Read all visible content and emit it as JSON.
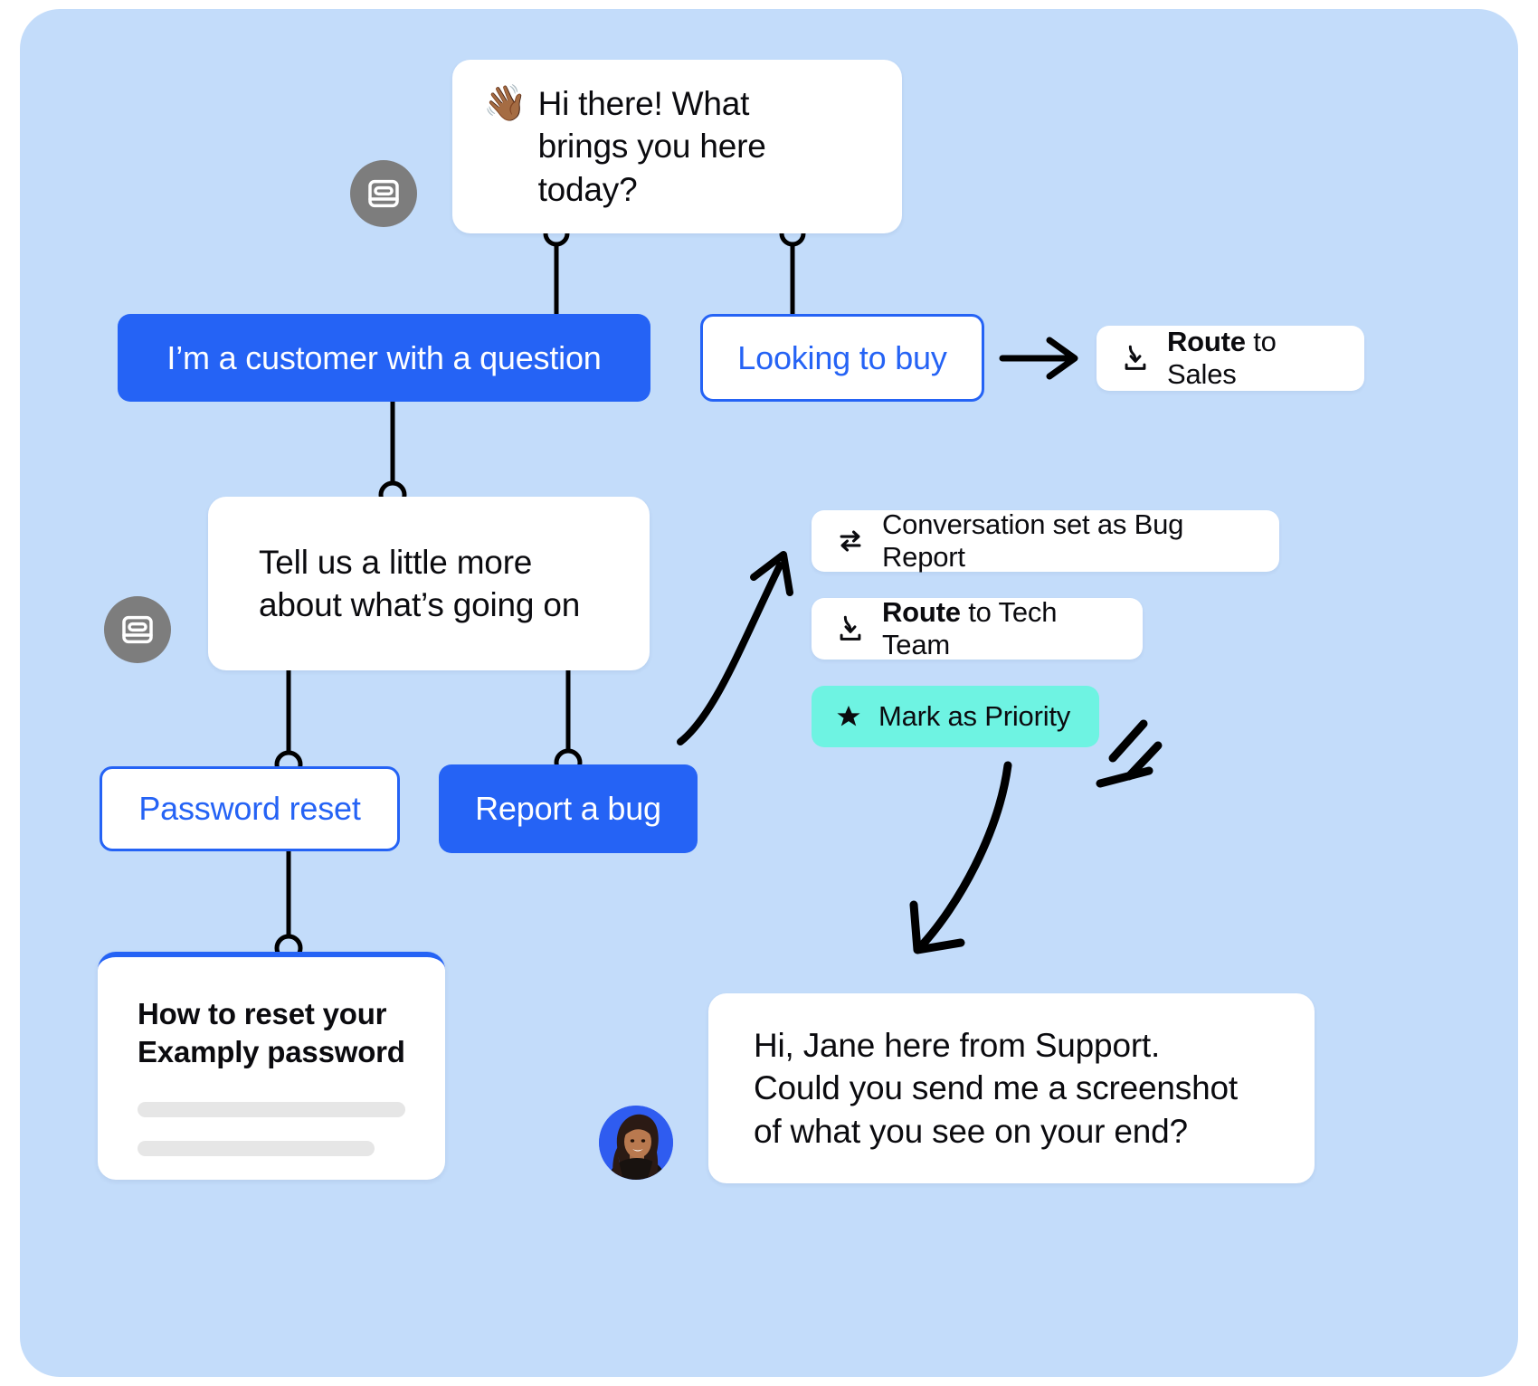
{
  "colors": {
    "stage_bg": "#c3dcfa",
    "primary_blue": "#2563f5",
    "mint": "#6ef3e2",
    "bot_avatar_gray": "#7d7d7d",
    "card_white": "#ffffff",
    "text_dark": "#0b0b0f",
    "skeleton_gray": "#e6e6e6"
  },
  "flow": {
    "greeting_bubble": {
      "emoji": "👋🏾",
      "emoji_name": "waving-hand-emoji",
      "text": "Hi there! What\nbrings you here today?"
    },
    "followup_bubble": {
      "text": "Tell us a little more\nabout what’s going on"
    },
    "choices": [
      {
        "label": "I’m a customer with a question",
        "style": "filled"
      },
      {
        "label": "Looking to buy",
        "style": "outline"
      },
      {
        "label": "Password reset",
        "style": "outline"
      },
      {
        "label": "Report a bug",
        "style": "filled"
      }
    ],
    "actions": [
      {
        "icon": "transfer-icon",
        "prefix": "",
        "label": "Conversation set as Bug Report",
        "style": "white"
      },
      {
        "icon": "route-icon",
        "prefix": "Route",
        "label": " to Tech Team",
        "style": "white"
      },
      {
        "icon": "star-icon",
        "prefix": "",
        "label": "Mark as Priority",
        "style": "mint"
      }
    ],
    "sales_action": {
      "icon": "route-icon",
      "prefix": "Route",
      "label": " to Sales"
    },
    "article_card": {
      "title": "How to reset your\nExamply password"
    },
    "agent_message": {
      "text": "Hi, Jane here from Support.\nCould you send me a screenshot\nof what you see on your end?"
    }
  }
}
